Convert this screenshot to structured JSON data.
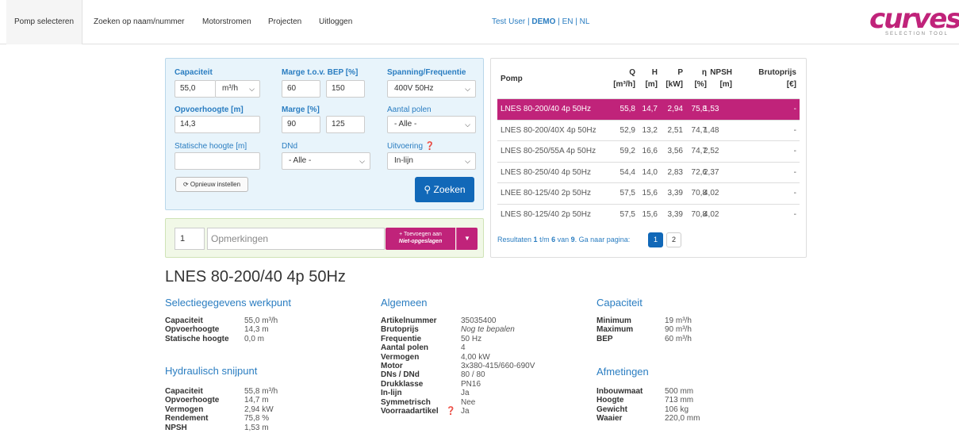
{
  "nav": {
    "tabs": [
      "Pomp selecteren",
      "Zoeken op naam/nummer",
      "Motorstromen",
      "Projecten",
      "Uitloggen"
    ],
    "user": "Test User",
    "mode": "DEMO",
    "lang_en": "EN",
    "lang_nl": "NL",
    "sep": "|",
    "logo": "curves",
    "logo_sub": "SELECTION TOOL"
  },
  "filter": {
    "capacity_label": "Capaciteit",
    "capacity_value": "55,0",
    "capacity_unit": "m³/h",
    "marge_bep_label": "Marge t.o.v. BEP [%]",
    "marge_bep_min": "60",
    "marge_bep_max": "150",
    "voltage_label": "Spanning/Frequentie",
    "voltage_value": "400V 50Hz",
    "head_label": "Opvoerhoogte [m]",
    "head_value": "14,3",
    "marge_label": "Marge [%]",
    "marge_min": "90",
    "marge_max": "125",
    "poles_label": "Aantal polen",
    "poles_value": "- Alle -",
    "static_label": "Statische hoogte [m]",
    "static_value": "",
    "dnd_label": "DNd",
    "dnd_value": "- Alle -",
    "execution_label": "Uitvoering",
    "execution_value": "In-lijn",
    "reset_label": "Opnieuw instellen",
    "search_label": "Zoeken"
  },
  "remarks": {
    "qty": "1",
    "placeholder": "Opmerkingen",
    "add_line1": "Toevoegen aan",
    "add_line2": "Niet-opgeslagen"
  },
  "results": {
    "headers": {
      "pump": "Pomp",
      "q": "Q",
      "q_unit": "[m³/h]",
      "h": "H",
      "h_unit": "[m]",
      "p": "P",
      "p_unit": "[kW]",
      "eta": "η",
      "eta_unit": "[%]",
      "npsh": "NPSH",
      "npsh_unit": "[m]",
      "price": "Brutoprijs",
      "price_unit": "[€]"
    },
    "rows": [
      {
        "name": "LNES 80-200/40 4p 50Hz",
        "q": "55,8",
        "h": "14,7",
        "p": "2,94",
        "eta": "75,8",
        "npsh": "1,53",
        "price": "-"
      },
      {
        "name": "LNES 80-200/40X 4p 50Hz",
        "q": "52,9",
        "h": "13,2",
        "p": "2,51",
        "eta": "74,7",
        "npsh": "1,48",
        "price": "-"
      },
      {
        "name": "LNES 80-250/55A 4p 50Hz",
        "q": "59,2",
        "h": "16,6",
        "p": "3,56",
        "eta": "74,7",
        "npsh": "2,52",
        "price": "-"
      },
      {
        "name": "LNES 80-250/40 4p 50Hz",
        "q": "54,4",
        "h": "14,0",
        "p": "2,83",
        "eta": "72,6",
        "npsh": "2,37",
        "price": "-"
      },
      {
        "name": "LNEE 80-125/40 2p 50Hz",
        "q": "57,5",
        "h": "15,6",
        "p": "3,39",
        "eta": "70,8",
        "npsh": "4,02",
        "price": "-"
      },
      {
        "name": "LNES 80-125/40 2p 50Hz",
        "q": "57,5",
        "h": "15,6",
        "p": "3,39",
        "eta": "70,8",
        "npsh": "4,02",
        "price": "-"
      }
    ],
    "pager_prefix": "Resultaten",
    "pager_from": "1",
    "pager_tm": "t/m",
    "pager_to": "6",
    "pager_van": "van",
    "pager_total": "9",
    "pager_suffix": ". Ga naar pagina:",
    "page1": "1",
    "page2": "2"
  },
  "detail": {
    "title": "LNES 80-200/40 4p 50Hz",
    "sel_heading": "Selectiegegevens werkpunt",
    "sel": [
      {
        "k": "Capaciteit",
        "v": "55,0 m³/h"
      },
      {
        "k": "Opvoerhoogte",
        "v": "14,3 m"
      },
      {
        "k": "Statische hoogte",
        "v": "0,0 m"
      }
    ],
    "hyd_heading": "Hydraulisch snijpunt",
    "hyd": [
      {
        "k": "Capaciteit",
        "v": "55,8 m³/h"
      },
      {
        "k": "Opvoerhoogte",
        "v": "14,7 m"
      },
      {
        "k": "Vermogen",
        "v": "2,94 kW"
      },
      {
        "k": "Rendement",
        "v": "75,8 %"
      },
      {
        "k": "NPSH",
        "v": "1,53 m"
      }
    ],
    "gen_heading": "Algemeen",
    "gen": [
      {
        "k": "Artikelnummer",
        "v": "35035400"
      },
      {
        "k": "Brutoprijs",
        "v": "Nog te bepalen"
      },
      {
        "k": "Frequentie",
        "v": "50 Hz"
      },
      {
        "k": "Aantal polen",
        "v": "4"
      },
      {
        "k": "Vermogen",
        "v": "4,00 kW"
      },
      {
        "k": "Motor",
        "v": "3x380-415/660-690V"
      },
      {
        "k": "DNs / DNd",
        "v": "80 / 80"
      },
      {
        "k": "Drukklasse",
        "v": "PN16"
      },
      {
        "k": "In-lijn",
        "v": "Ja"
      },
      {
        "k": "Symmetrisch",
        "v": "Nee"
      },
      {
        "k": "Voorraadartikel",
        "v": "Ja"
      }
    ],
    "cap_heading": "Capaciteit",
    "cap": [
      {
        "k": "Minimum",
        "v": "19 m³/h"
      },
      {
        "k": "Maximum",
        "v": "90 m³/h"
      },
      {
        "k": "BEP",
        "v": "60 m³/h"
      }
    ],
    "dim_heading": "Afmetingen",
    "dim": [
      {
        "k": "Inbouwmaat",
        "v": "500 mm"
      },
      {
        "k": "Hoogte",
        "v": "713 mm"
      },
      {
        "k": "Gewicht",
        "v": "106 kg"
      },
      {
        "k": "Waaier",
        "v": "220,0 mm"
      }
    ]
  },
  "colors": {
    "accent_magenta": "#c0237a",
    "primary_blue": "#1168b8",
    "link_blue": "#2a7dc1",
    "filter_bg": "#e8f4fb",
    "remarks_bg": "#f1f8e7"
  }
}
